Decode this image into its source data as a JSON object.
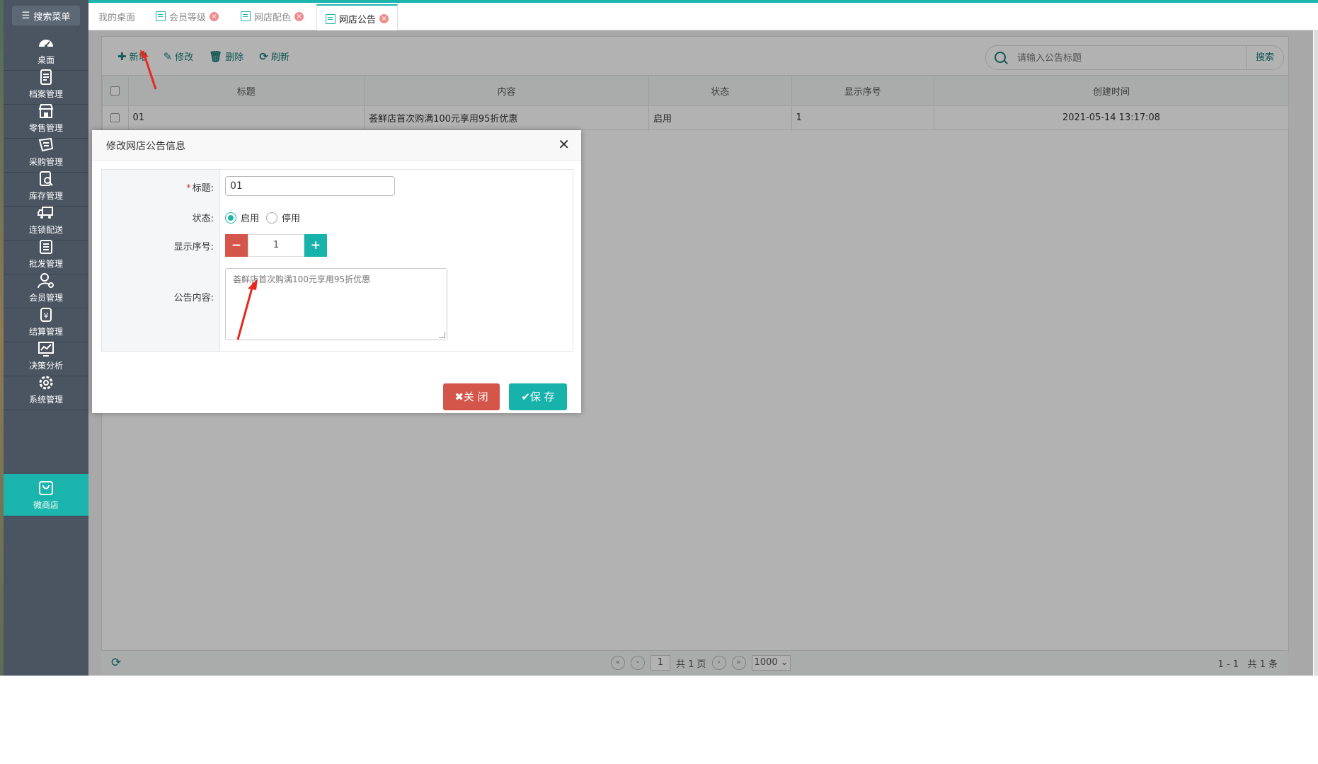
{
  "sidebar": {
    "search_label": "搜索菜单",
    "items": [
      {
        "label": "桌面",
        "icon": "dashboard-icon"
      },
      {
        "label": "档案管理",
        "icon": "archive-icon"
      },
      {
        "label": "零售管理",
        "icon": "store-icon"
      },
      {
        "label": "采购管理",
        "icon": "purchase-icon"
      },
      {
        "label": "库存管理",
        "icon": "inventory-icon"
      },
      {
        "label": "连锁配送",
        "icon": "delivery-truck-icon"
      },
      {
        "label": "批发管理",
        "icon": "wholesale-icon"
      },
      {
        "label": "会员管理",
        "icon": "member-icon"
      },
      {
        "label": "结算管理",
        "icon": "settlement-icon"
      },
      {
        "label": "决策分析",
        "icon": "analytics-icon"
      },
      {
        "label": "系统管理",
        "icon": "gear-icon"
      },
      {
        "label": "微商店",
        "icon": "shopping-bag-icon"
      }
    ]
  },
  "tabs": [
    {
      "label": "我的桌面"
    },
    {
      "label": "会员等级"
    },
    {
      "label": "网店配色"
    },
    {
      "label": "网店公告"
    }
  ],
  "toolbar": {
    "add": "新增",
    "edit": "修改",
    "delete": "删除",
    "refresh": "刷新"
  },
  "search": {
    "placeholder": "请输入公告标题",
    "button": "搜索"
  },
  "table": {
    "columns": [
      "标题",
      "内容",
      "状态",
      "显示序号",
      "创建时间"
    ],
    "rows": [
      {
        "title": "01",
        "content": "荟鲜店首次购满100元享用95折优惠",
        "status": "启用",
        "order": "1",
        "created": "2021-05-14 13:17:08"
      }
    ]
  },
  "pager": {
    "page": "1",
    "total_pages": "共 1 页",
    "page_size": "1000",
    "range": "1 - 1",
    "total": "共 1 条"
  },
  "modal": {
    "title": "修改网店公告信息",
    "title_label": "标题:",
    "title_value": "01",
    "status_label": "状态:",
    "status_on": "启用",
    "status_off": "停用",
    "order_label": "显示序号:",
    "order_value": "1",
    "content_label": "公告内容:",
    "content_value": "荟鲜店首次购满100元享用95折优惠",
    "close_btn": "✖关 闭",
    "save_btn": "✔保 存"
  },
  "colors": {
    "accent": "#1bb5ad",
    "danger": "#d4564b",
    "sidebar": "#4a5561"
  }
}
